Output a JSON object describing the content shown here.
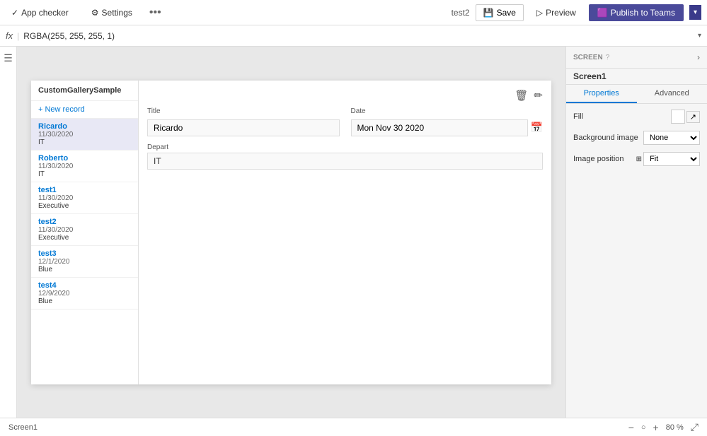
{
  "topbar": {
    "app_checker_label": "App checker",
    "settings_label": "Settings",
    "app_name": "test2",
    "save_label": "Save",
    "preview_label": "Preview",
    "publish_label": "Publish to Teams",
    "dots": "..."
  },
  "formulabar": {
    "fx_label": "fx",
    "formula": "RGBA(255, 255, 255, 1)"
  },
  "canvas": {
    "gallery_title": "CustomGallerySample",
    "new_record_label": "+ New record",
    "items": [
      {
        "name": "Ricardo",
        "date": "11/30/2020",
        "dept": "IT",
        "selected": true
      },
      {
        "name": "Roberto",
        "date": "11/30/2020",
        "dept": "IT",
        "selected": false
      },
      {
        "name": "test1",
        "date": "11/30/2020",
        "dept": "Executive",
        "selected": false
      },
      {
        "name": "test2",
        "date": "11/30/2020",
        "dept": "Executive",
        "selected": false
      },
      {
        "name": "test3",
        "date": "12/1/2020",
        "dept": "Blue",
        "selected": false
      },
      {
        "name": "test4",
        "date": "12/9/2020",
        "dept": "Blue",
        "selected": false
      }
    ],
    "form": {
      "title_label": "Title",
      "title_value": "Ricardo",
      "date_label": "Date",
      "date_value": "Mon Nov 30 2020",
      "depart_label": "Depart",
      "depart_value": "IT"
    }
  },
  "right_panel": {
    "screen_label": "SCREEN",
    "screen_name": "Screen1",
    "properties_tab": "Properties",
    "advanced_tab": "Advanced",
    "fill_label": "Fill",
    "background_image_label": "Background image",
    "background_image_value": "None",
    "image_position_label": "Image position",
    "image_position_value": "Fit"
  },
  "statusbar": {
    "screen_name": "Screen1",
    "zoom": "80 %"
  }
}
